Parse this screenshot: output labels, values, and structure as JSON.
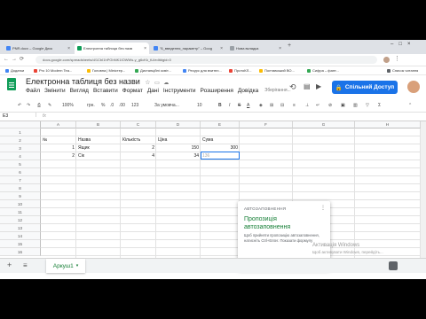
{
  "browser": {
    "tabs": [
      {
        "label": "PNR.docx – Google Диск",
        "color": "#4285f4"
      },
      {
        "label": "Електронна таблиця без назв",
        "color": "#0f9d58"
      },
      {
        "label": "\"6_введення_параметр\" – Goog",
        "color": "#4285f4"
      },
      {
        "label": "Нова вкладка",
        "color": "#9aa0a6"
      }
    ],
    "url": "docs.google.com/spreadsheets/d/1CbI1hPGhNK1IOWWs-y_g6cKk_tU/edit#gid=0",
    "bookmarks": [
      {
        "label": "Додатки",
        "color": "#4285f4"
      },
      {
        "label": "Pro 10 Modern Tea...",
        "color": "#ea4335"
      },
      {
        "label": "Головна | Міністер...",
        "color": "#fbbc04"
      },
      {
        "label": "Дистанційні освіт...",
        "color": "#34a853"
      },
      {
        "label": "Ресурс для вчител...",
        "color": "#4285f4"
      },
      {
        "label": "ПротоКЛ...",
        "color": "#ea4335"
      },
      {
        "label": "Полтавський ВО...",
        "color": "#fbbc04"
      },
      {
        "label": "Сифра – фант...",
        "color": "#34a853"
      },
      {
        "label": "Список читання",
        "color": "#5f6368"
      }
    ]
  },
  "doc": {
    "title": "Електронна таблиця без назви",
    "save_status": "Зберігання...",
    "menu": [
      "Файл",
      "Змінити",
      "Вигляд",
      "Вставити",
      "Формат",
      "Дані",
      "Інструменти",
      "Розширення",
      "Довідка"
    ],
    "share_label": "Спільний Доступ"
  },
  "toolbar": {
    "zoom": "100%",
    "currency": "грн.",
    "percent": "%",
    "dec0": ".0",
    "dec00": ".00",
    "format_123": "123",
    "font": "За умовча...",
    "font_size": "10",
    "bold": "B",
    "italic": "I",
    "strike": "S",
    "text_color": "A"
  },
  "formula": {
    "cell_ref": "E3",
    "fx": "fx"
  },
  "sheet": {
    "columns": [
      "A",
      "B",
      "C",
      "D",
      "E",
      "F",
      "G",
      "H"
    ],
    "rows": [
      "1",
      "2",
      "3",
      "4",
      "5",
      "6",
      "7",
      "8",
      "9",
      "10",
      "11",
      "12",
      "13",
      "14",
      "15",
      "16"
    ],
    "headers": {
      "num": "№",
      "name": "Назва",
      "qty": "Кількість",
      "price": "Ціна",
      "sum": "Сума"
    },
    "data_rows": [
      {
        "num": "1",
        "name": "Ящик",
        "qty": "2",
        "price": "150",
        "sum": "300"
      },
      {
        "num": "2",
        "name": "Сік",
        "qty": "4",
        "price": "34",
        "sum": "136"
      }
    ]
  },
  "autofill": {
    "title": "АВТОЗАПОВНЕННЯ",
    "headline": "Пропозиція автозаповнення",
    "body": "Щоб прийняти пропозицію автозаповнення, натисніть Ctrl+Enter. Показати формулу",
    "accept_icon": "✓",
    "reject_icon": "✕"
  },
  "watermark": {
    "line1": "Активація Windows",
    "line2": "Щоб активувати Windows, перейдіть..."
  },
  "sheetbar": {
    "tab_label": "Аркуш1",
    "add_icon": "+",
    "list_icon": "≡"
  }
}
